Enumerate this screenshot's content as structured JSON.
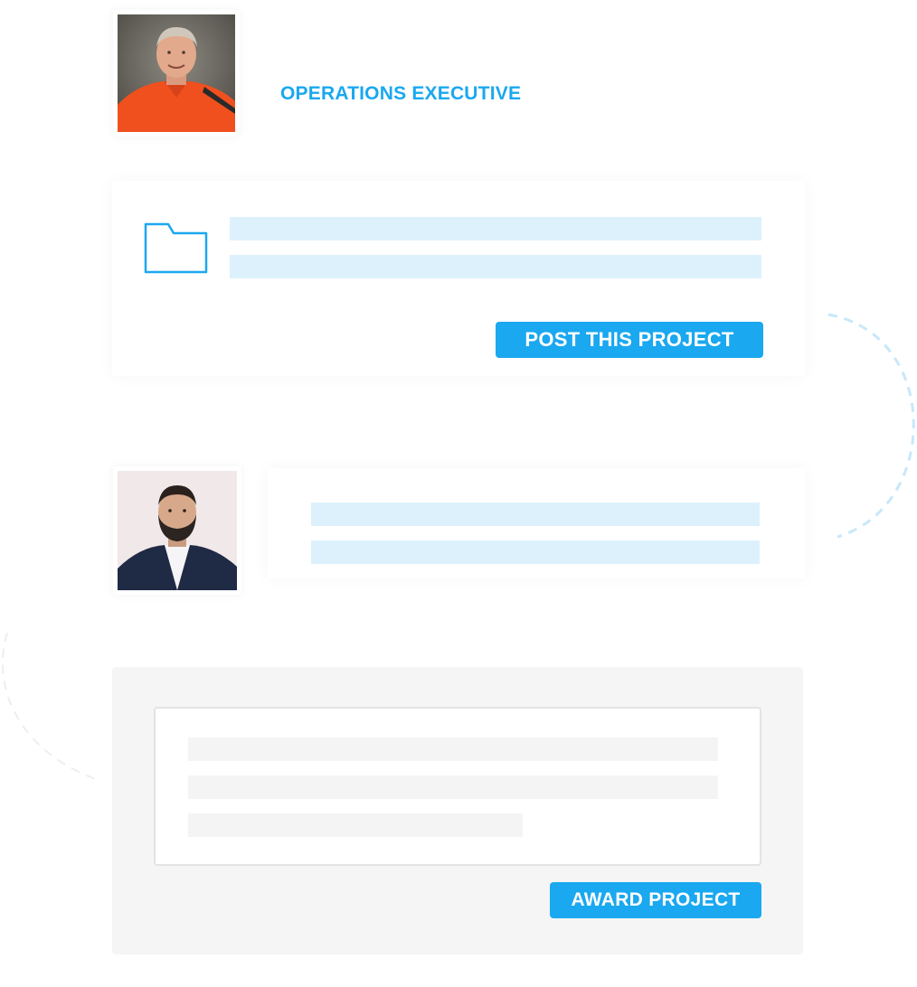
{
  "executive": {
    "role_label": "OPERATIONS EXECUTIVE"
  },
  "post_card": {
    "icon": "folder-icon",
    "button_label": "POST THIS PROJECT"
  },
  "award_panel": {
    "button_label": "AWARD PROJECT"
  },
  "colors": {
    "accent": "#1aa8f0",
    "placeholder_blue": "#dcf1fc",
    "placeholder_grey": "#f4f4f4",
    "panel_grey": "#f5f5f5"
  }
}
